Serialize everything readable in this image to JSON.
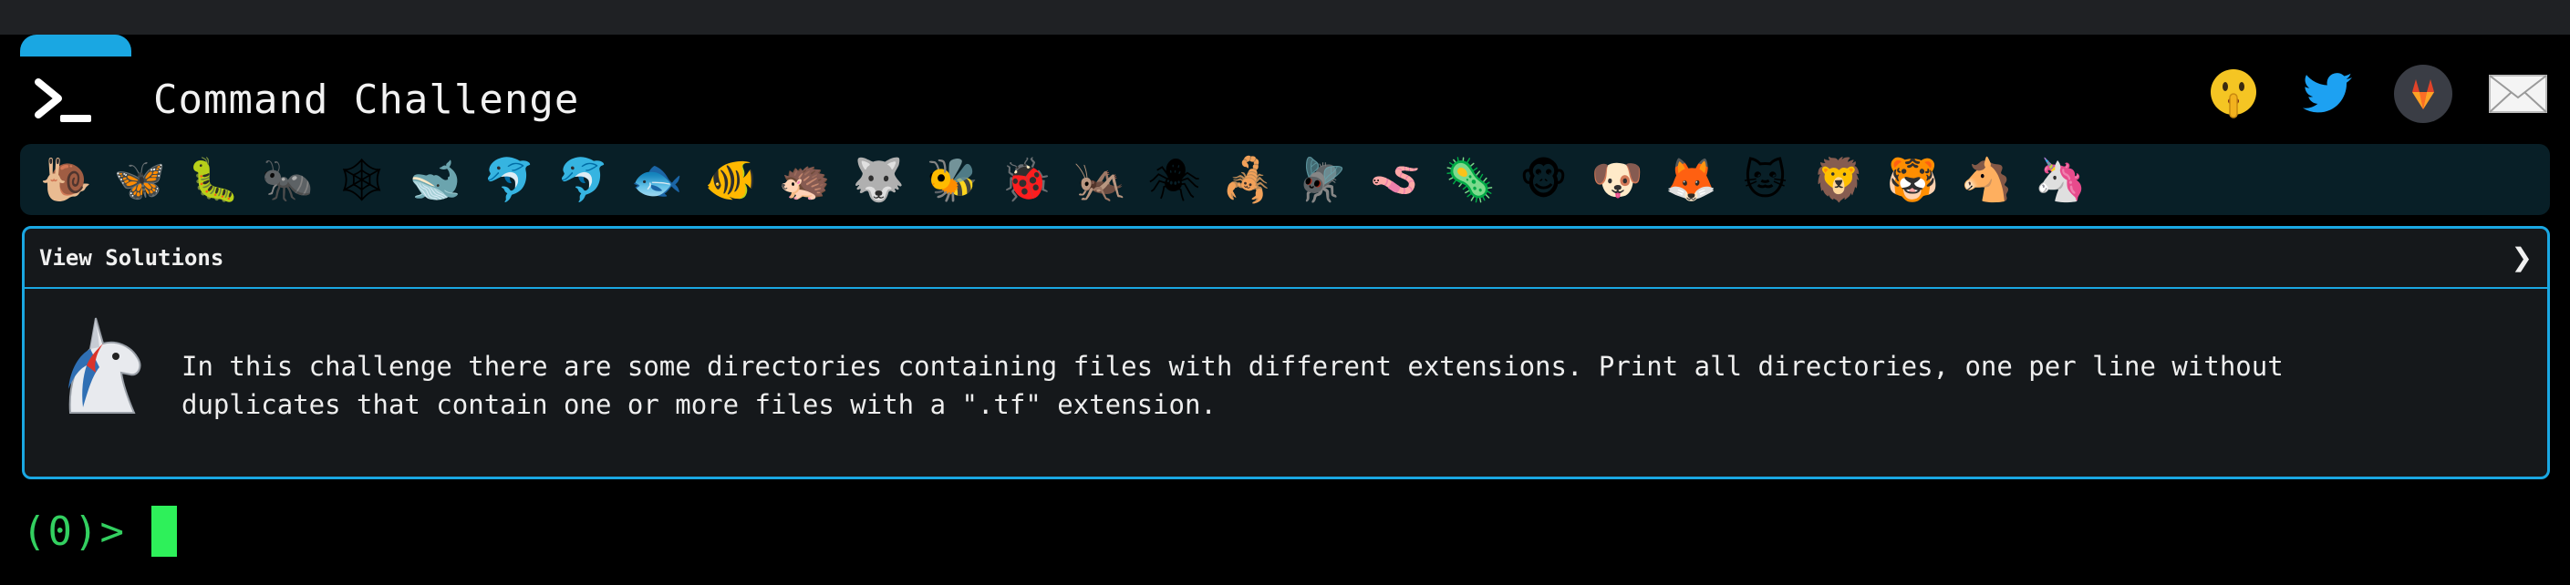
{
  "header": {
    "title": "Command Challenge"
  },
  "socials": [
    {
      "name": "shushing-face-icon"
    },
    {
      "name": "twitter-icon"
    },
    {
      "name": "gitlab-icon"
    },
    {
      "name": "mail-icon"
    }
  ],
  "animals": [
    "🐌",
    "🦋",
    "🐛",
    "🐜",
    "🕸",
    "🐋",
    "🐬",
    "🐬",
    "🐟",
    "🐠",
    "🦔",
    "🐺",
    "🐝",
    "🐞",
    "🦗",
    "🕷",
    "🦂",
    "🪰",
    "🪱",
    "🦠",
    "🐵",
    "🐶",
    "🦊",
    "🐱",
    "🦁",
    "🐯",
    "🐴",
    "🦄"
  ],
  "panel": {
    "header_label": "View Solutions",
    "chevron": "❯",
    "description": "In this challenge there are some directories containing files with different extensions. Print all directories, one per line without\nduplicates that contain one or more files with a \".tf\" extension."
  },
  "terminal": {
    "prompt": "(0)>"
  },
  "colors": {
    "accent": "#1aa7e2",
    "prompt_green": "#33d060",
    "cursor_green": "#2ef05a"
  }
}
